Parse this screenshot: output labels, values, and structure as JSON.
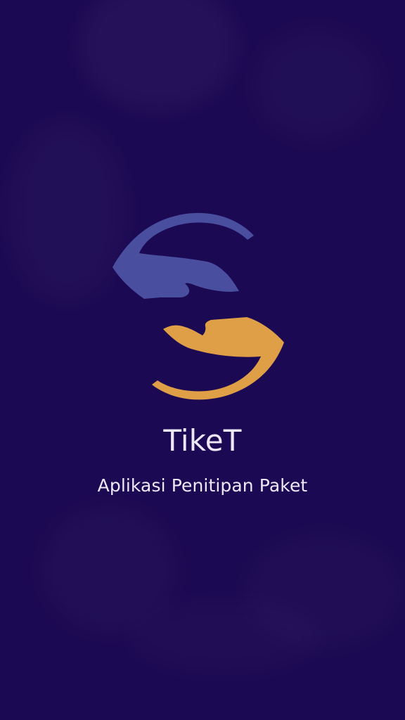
{
  "app": {
    "title": "TikeT",
    "subtitle": "Aplikasi Penitipan Paket"
  },
  "logo": {
    "icon_name": "handover-hands-icon",
    "colors": {
      "top_hand": "#4a4e9f",
      "bottom_hand": "#df9f47"
    }
  },
  "theme": {
    "background": "#1c0953",
    "text": "#ece8f7"
  }
}
